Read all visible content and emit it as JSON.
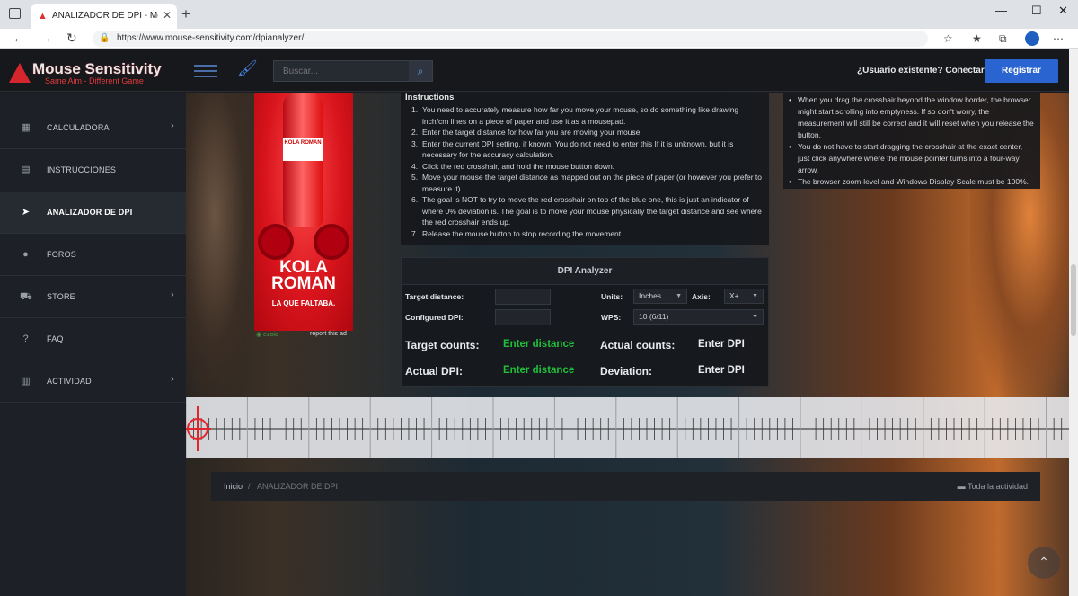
{
  "browser": {
    "tab_title": "ANALIZADOR DE DPI - Mouse Se",
    "url": "https://www.mouse-sensitivity.com/dpianalyzer/"
  },
  "header": {
    "logo_title": "Mouse Sensitivity",
    "logo_subtitle": "Same Aim - Different Game",
    "search_placeholder": "Buscar...",
    "login_text": "¿Usuario existente? Conectar",
    "register_label": "Registrar"
  },
  "sidebar": {
    "items": [
      {
        "label": "CALCULADORA",
        "icon": "calculator-icon",
        "chevron": true
      },
      {
        "label": "INSTRUCCIONES",
        "icon": "book-icon",
        "chevron": false
      },
      {
        "label": "ANALIZADOR DE DPI",
        "icon": "cursor-icon",
        "chevron": false,
        "active": true
      },
      {
        "label": "FOROS",
        "icon": "comments-icon",
        "chevron": false
      },
      {
        "label": "STORE",
        "icon": "cart-icon",
        "chevron": true
      },
      {
        "label": "FAQ",
        "icon": "question-icon",
        "chevron": false
      },
      {
        "label": "ACTIVIDAD",
        "icon": "chart-icon",
        "chevron": true
      }
    ]
  },
  "ad": {
    "brand_line1": "KOLA",
    "brand_line2": "ROMAN",
    "tagline": "LA QUE FALTABA.",
    "bottle_label": "KOLA ROMAN",
    "report": "report this ad"
  },
  "instructions": {
    "title": "Instructions",
    "steps": [
      "You need to accurately measure how far you move your mouse, so do something like drawing inch/cm lines on a piece of paper and use it as a mousepad.",
      "Enter the target distance for how far you are moving your mouse.",
      "Enter the current DPI setting, if known. You do not need to enter this If it is unknown, but it is necessary for the accuracy calculation.",
      "Click the red crosshair, and hold the mouse button down.",
      "Move your mouse the target distance as mapped out on the piece of paper (or however you prefer to measure it).",
      "The goal is NOT to try to move the red crosshair on top of the blue one, this is just an indicator of where 0% deviation is. The goal is to move your mouse physically the target distance and see where the red crosshair ends up.",
      "Release the mouse button to stop recording the movement."
    ],
    "tips": [
      "When you drag the crosshair beyond the window border, the browser might start scrolling into emptyness. If so don't worry, the measurement will still be correct and it will reset when you release the button.",
      "You do not have to start dragging the crosshair at the exact center, just click anywhere where the mouse pointer turns into a four-way arrow.",
      "The browser zoom-level and Windows Display Scale must be 100%."
    ]
  },
  "dpi_analyzer": {
    "title": "DPI Analyzer",
    "target_distance_label": "Target distance:",
    "configured_dpi_label": "Configured DPI:",
    "units_label": "Units:",
    "units_value": "Inches",
    "axis_label": "Axis:",
    "axis_value": "X+",
    "wps_label": "WPS:",
    "wps_value": "10 (6/11)",
    "target_counts_label": "Target counts:",
    "target_counts_value": "Enter distance",
    "actual_counts_label": "Actual counts:",
    "actual_counts_value": "Enter DPI",
    "actual_dpi_label": "Actual DPI:",
    "actual_dpi_value": "Enter distance",
    "deviation_label": "Deviation:",
    "deviation_value": "Enter DPI"
  },
  "breadcrumb": {
    "home": "Inicio",
    "separator": "/",
    "current": "ANALIZADOR DE DPI",
    "activity": "Toda la actividad"
  },
  "colors": {
    "accent": "#2a64d0",
    "green_value": "#21c03a",
    "crosshair": "#e0262d"
  }
}
